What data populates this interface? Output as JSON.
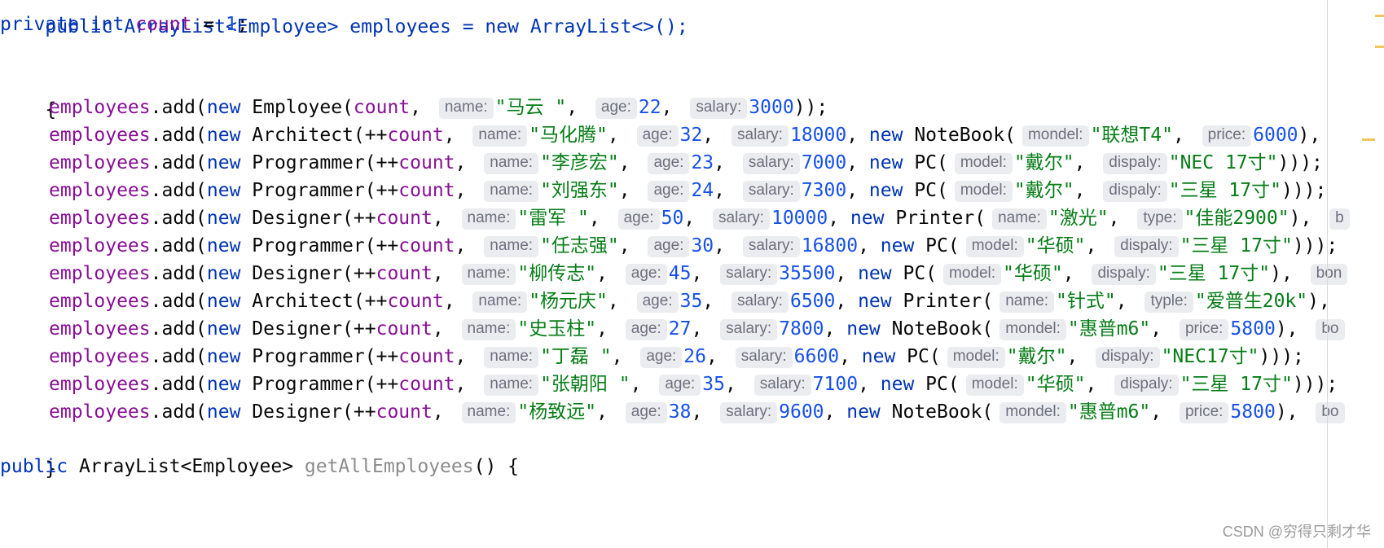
{
  "code": {
    "line_top": "public ArrayList<Employee> employees = new ArrayList<>();",
    "line_private": {
      "kw1": "private",
      "kw2": "int",
      "field": "count",
      "eq": " = ",
      "value": "1",
      "end": ";"
    },
    "open_brace": "{",
    "close_brace": "}",
    "getter": {
      "kw": "public",
      "type": " ArrayList<Employee> ",
      "name": "getAllEmployees",
      "rest": "() {"
    },
    "employee_lines": [
      [
        [
          "fld",
          "employees"
        ],
        [
          "p",
          ".add("
        ],
        [
          "kw",
          "new"
        ],
        [
          "p",
          " Employee("
        ],
        [
          "fld",
          "count"
        ],
        [
          "p",
          ", "
        ],
        [
          "h",
          "name:"
        ],
        [
          "str",
          "\"马云 \""
        ],
        [
          "p",
          ", "
        ],
        [
          "h",
          "age:"
        ],
        [
          "num",
          "22"
        ],
        [
          "p",
          ", "
        ],
        [
          "h",
          "salary:"
        ],
        [
          "num",
          "3000"
        ],
        [
          "p",
          "));"
        ]
      ],
      [
        [
          "fld",
          "employees"
        ],
        [
          "p",
          ".add("
        ],
        [
          "kw",
          "new"
        ],
        [
          "p",
          " Architect(++"
        ],
        [
          "fld",
          "count"
        ],
        [
          "p",
          ", "
        ],
        [
          "h",
          "name:"
        ],
        [
          "str",
          "\"马化腾\""
        ],
        [
          "p",
          ", "
        ],
        [
          "h",
          "age:"
        ],
        [
          "num",
          "32"
        ],
        [
          "p",
          ", "
        ],
        [
          "h",
          "salary:"
        ],
        [
          "num",
          "18000"
        ],
        [
          "p",
          ", "
        ],
        [
          "kw",
          "new"
        ],
        [
          "p",
          " NoteBook("
        ],
        [
          "h",
          "mondel:"
        ],
        [
          "str",
          "\"联想T4\""
        ],
        [
          "p",
          ", "
        ],
        [
          "h",
          "price:"
        ],
        [
          "num",
          "6000"
        ],
        [
          "p",
          "), "
        ]
      ],
      [
        [
          "fld",
          "employees"
        ],
        [
          "p",
          ".add("
        ],
        [
          "kw",
          "new"
        ],
        [
          "p",
          " Programmer(++"
        ],
        [
          "fld",
          "count"
        ],
        [
          "p",
          ", "
        ],
        [
          "h",
          "name:"
        ],
        [
          "str",
          "\"李彦宏\""
        ],
        [
          "p",
          ", "
        ],
        [
          "h",
          "age:"
        ],
        [
          "num",
          "23"
        ],
        [
          "p",
          ", "
        ],
        [
          "h",
          "salary:"
        ],
        [
          "num",
          "7000"
        ],
        [
          "p",
          ", "
        ],
        [
          "kw",
          "new"
        ],
        [
          "p",
          " PC("
        ],
        [
          "h",
          "model:"
        ],
        [
          "str",
          "\"戴尔\""
        ],
        [
          "p",
          ", "
        ],
        [
          "h",
          "dispaly:"
        ],
        [
          "str",
          "\"NEC 17寸\""
        ],
        [
          "p",
          ")));"
        ]
      ],
      [
        [
          "fld",
          "employees"
        ],
        [
          "p",
          ".add("
        ],
        [
          "kw",
          "new"
        ],
        [
          "p",
          " Programmer(++"
        ],
        [
          "fld",
          "count"
        ],
        [
          "p",
          ", "
        ],
        [
          "h",
          "name:"
        ],
        [
          "str",
          "\"刘强东\""
        ],
        [
          "p",
          ", "
        ],
        [
          "h",
          "age:"
        ],
        [
          "num",
          "24"
        ],
        [
          "p",
          ", "
        ],
        [
          "h",
          "salary:"
        ],
        [
          "num",
          "7300"
        ],
        [
          "p",
          ", "
        ],
        [
          "kw",
          "new"
        ],
        [
          "p",
          " PC("
        ],
        [
          "h",
          "model:"
        ],
        [
          "str",
          "\"戴尔\""
        ],
        [
          "p",
          ", "
        ],
        [
          "h",
          "dispaly:"
        ],
        [
          "str",
          "\"三星 17寸\""
        ],
        [
          "p",
          ")));"
        ]
      ],
      [
        [
          "fld",
          "employees"
        ],
        [
          "p",
          ".add("
        ],
        [
          "kw",
          "new"
        ],
        [
          "p",
          " Designer(++"
        ],
        [
          "fld",
          "count"
        ],
        [
          "p",
          ", "
        ],
        [
          "h",
          "name:"
        ],
        [
          "str",
          "\"雷军 \""
        ],
        [
          "p",
          ", "
        ],
        [
          "h",
          "age:"
        ],
        [
          "num",
          "50"
        ],
        [
          "p",
          ", "
        ],
        [
          "h",
          "salary:"
        ],
        [
          "num",
          "10000"
        ],
        [
          "p",
          ", "
        ],
        [
          "kw",
          "new"
        ],
        [
          "p",
          " Printer("
        ],
        [
          "h",
          "name:"
        ],
        [
          "str",
          "\"激光\""
        ],
        [
          "p",
          ", "
        ],
        [
          "h",
          "type:"
        ],
        [
          "str",
          "\"佳能2900\""
        ],
        [
          "p",
          "), "
        ],
        [
          "h",
          "b"
        ]
      ],
      [
        [
          "fld",
          "employees"
        ],
        [
          "p",
          ".add("
        ],
        [
          "kw",
          "new"
        ],
        [
          "p",
          " Programmer(++"
        ],
        [
          "fld",
          "count"
        ],
        [
          "p",
          ", "
        ],
        [
          "h",
          "name:"
        ],
        [
          "str",
          "\"任志强\""
        ],
        [
          "p",
          ", "
        ],
        [
          "h",
          "age:"
        ],
        [
          "num",
          "30"
        ],
        [
          "p",
          ", "
        ],
        [
          "h",
          "salary:"
        ],
        [
          "num",
          "16800"
        ],
        [
          "p",
          ", "
        ],
        [
          "kw",
          "new"
        ],
        [
          "p",
          " PC("
        ],
        [
          "h",
          "model:"
        ],
        [
          "str",
          "\"华硕\""
        ],
        [
          "p",
          ", "
        ],
        [
          "h",
          "dispaly:"
        ],
        [
          "str",
          "\"三星 17寸\""
        ],
        [
          "p",
          ")));"
        ]
      ],
      [
        [
          "fld",
          "employees"
        ],
        [
          "p",
          ".add("
        ],
        [
          "kw",
          "new"
        ],
        [
          "p",
          " Designer(++"
        ],
        [
          "fld",
          "count"
        ],
        [
          "p",
          ", "
        ],
        [
          "h",
          "name:"
        ],
        [
          "str",
          "\"柳传志\""
        ],
        [
          "p",
          ", "
        ],
        [
          "h",
          "age:"
        ],
        [
          "num",
          "45"
        ],
        [
          "p",
          ", "
        ],
        [
          "h",
          "salary:"
        ],
        [
          "num",
          "35500"
        ],
        [
          "p",
          ", "
        ],
        [
          "kw",
          "new"
        ],
        [
          "p",
          " PC("
        ],
        [
          "h",
          "model:"
        ],
        [
          "str",
          "\"华硕\""
        ],
        [
          "p",
          ", "
        ],
        [
          "h",
          "dispaly:"
        ],
        [
          "str",
          "\"三星 17寸\""
        ],
        [
          "p",
          "), "
        ],
        [
          "h",
          "bon"
        ]
      ],
      [
        [
          "fld",
          "employees"
        ],
        [
          "p",
          ".add("
        ],
        [
          "kw",
          "new"
        ],
        [
          "p",
          " Architect(++"
        ],
        [
          "fld",
          "count"
        ],
        [
          "p",
          ", "
        ],
        [
          "h",
          "name:"
        ],
        [
          "str",
          "\"杨元庆\""
        ],
        [
          "p",
          ", "
        ],
        [
          "h",
          "age:"
        ],
        [
          "num",
          "35"
        ],
        [
          "p",
          ", "
        ],
        [
          "h",
          "salary:"
        ],
        [
          "num",
          "6500"
        ],
        [
          "p",
          ", "
        ],
        [
          "kw",
          "new"
        ],
        [
          "p",
          " Printer("
        ],
        [
          "h",
          "name:"
        ],
        [
          "str",
          "\"针式\""
        ],
        [
          "p",
          ", "
        ],
        [
          "h",
          "typle:"
        ],
        [
          "str",
          "\"爱普生20k\""
        ],
        [
          "p",
          "), "
        ]
      ],
      [
        [
          "fld",
          "employees"
        ],
        [
          "p",
          ".add("
        ],
        [
          "kw",
          "new"
        ],
        [
          "p",
          " Designer(++"
        ],
        [
          "fld",
          "count"
        ],
        [
          "p",
          ", "
        ],
        [
          "h",
          "name:"
        ],
        [
          "str",
          "\"史玉柱\""
        ],
        [
          "p",
          ", "
        ],
        [
          "h",
          "age:"
        ],
        [
          "num",
          "27"
        ],
        [
          "p",
          ", "
        ],
        [
          "h",
          "salary:"
        ],
        [
          "num",
          "7800"
        ],
        [
          "p",
          ", "
        ],
        [
          "kw",
          "new"
        ],
        [
          "p",
          " NoteBook("
        ],
        [
          "h",
          "mondel:"
        ],
        [
          "str",
          "\"惠普m6\""
        ],
        [
          "p",
          ", "
        ],
        [
          "h",
          "price:"
        ],
        [
          "num",
          "5800"
        ],
        [
          "p",
          "), "
        ],
        [
          "h",
          "bo"
        ]
      ],
      [
        [
          "fld",
          "employees"
        ],
        [
          "p",
          ".add("
        ],
        [
          "kw",
          "new"
        ],
        [
          "p",
          " Programmer(++"
        ],
        [
          "fld",
          "count"
        ],
        [
          "p",
          ", "
        ],
        [
          "h",
          "name:"
        ],
        [
          "str",
          "\"丁磊 \""
        ],
        [
          "p",
          ", "
        ],
        [
          "h",
          "age:"
        ],
        [
          "num",
          "26"
        ],
        [
          "p",
          ", "
        ],
        [
          "h",
          "salary:"
        ],
        [
          "num",
          "6600"
        ],
        [
          "p",
          ", "
        ],
        [
          "kw",
          "new"
        ],
        [
          "p",
          " PC("
        ],
        [
          "h",
          "model:"
        ],
        [
          "str",
          "\"戴尔\""
        ],
        [
          "p",
          ", "
        ],
        [
          "h",
          "dispaly:"
        ],
        [
          "str",
          "\"NEC17寸\""
        ],
        [
          "p",
          ")));"
        ]
      ],
      [
        [
          "fld",
          "employees"
        ],
        [
          "p",
          ".add("
        ],
        [
          "kw",
          "new"
        ],
        [
          "p",
          " Programmer(++"
        ],
        [
          "fld",
          "count"
        ],
        [
          "p",
          ", "
        ],
        [
          "h",
          "name:"
        ],
        [
          "str",
          "\"张朝阳 \""
        ],
        [
          "p",
          ", "
        ],
        [
          "h",
          "age:"
        ],
        [
          "num",
          "35"
        ],
        [
          "p",
          ", "
        ],
        [
          "h",
          "salary:"
        ],
        [
          "num",
          "7100"
        ],
        [
          "p",
          ", "
        ],
        [
          "kw",
          "new"
        ],
        [
          "p",
          " PC("
        ],
        [
          "h",
          "model:"
        ],
        [
          "str",
          "\"华硕\""
        ],
        [
          "p",
          ", "
        ],
        [
          "h",
          "dispaly:"
        ],
        [
          "str",
          "\"三星 17寸\""
        ],
        [
          "p",
          ")));"
        ]
      ],
      [
        [
          "fld",
          "employees"
        ],
        [
          "p",
          ".add("
        ],
        [
          "kw",
          "new"
        ],
        [
          "p",
          " Designer(++"
        ],
        [
          "fld",
          "count"
        ],
        [
          "p",
          ", "
        ],
        [
          "h",
          "name:"
        ],
        [
          "str",
          "\"杨致远\""
        ],
        [
          "p",
          ", "
        ],
        [
          "h",
          "age:"
        ],
        [
          "num",
          "38"
        ],
        [
          "p",
          ", "
        ],
        [
          "h",
          "salary:"
        ],
        [
          "num",
          "9600"
        ],
        [
          "p",
          ", "
        ],
        [
          "kw",
          "new"
        ],
        [
          "p",
          " NoteBook("
        ],
        [
          "h",
          "mondel:"
        ],
        [
          "str",
          "\"惠普m6\""
        ],
        [
          "p",
          ", "
        ],
        [
          "h",
          "price:"
        ],
        [
          "num",
          "5800"
        ],
        [
          "p",
          "), "
        ],
        [
          "h",
          "bo"
        ]
      ]
    ]
  },
  "watermark": "CSDN @穷得只剩才华",
  "colors": {
    "keyword": "#0033b3",
    "field": "#871094",
    "number": "#1750eb",
    "string": "#067d17",
    "hint_bg": "#ebecf0",
    "marker": "#f2c55c"
  }
}
